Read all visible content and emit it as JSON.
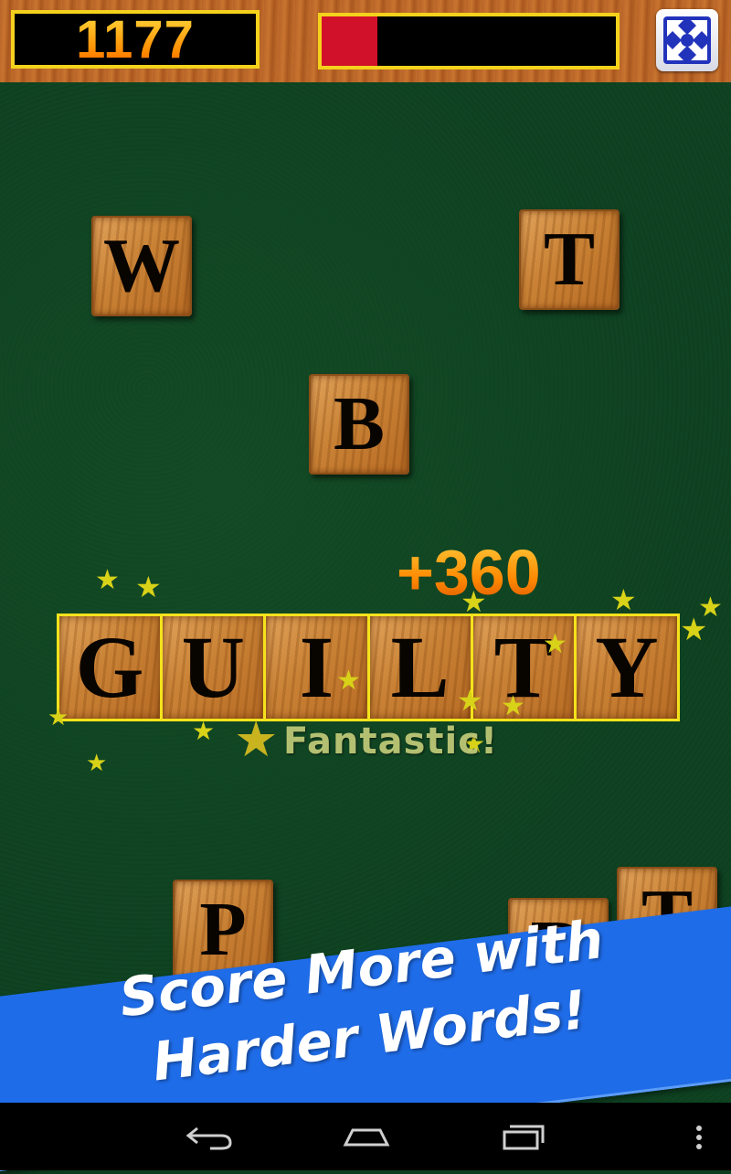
{
  "score": "1177",
  "progress": {
    "fraction": 0.19
  },
  "menu": {
    "icon": "shrink-arrows-icon"
  },
  "falling_tiles": [
    {
      "letter": "W"
    },
    {
      "letter": "T"
    },
    {
      "letter": "B"
    },
    {
      "letter": "P"
    },
    {
      "letter": "R"
    },
    {
      "letter": "T"
    }
  ],
  "word": {
    "letters": [
      "G",
      "U",
      "I",
      "L",
      "T",
      "Y"
    ]
  },
  "points_popup": "+360",
  "praise": "Fantastic!",
  "banner": {
    "line1": "Score More with",
    "line2": "Harder Words!"
  },
  "navbar": {
    "back": "back-icon",
    "home": "home-icon",
    "recents": "recents-icon",
    "menu": "overflow-menu-icon"
  }
}
